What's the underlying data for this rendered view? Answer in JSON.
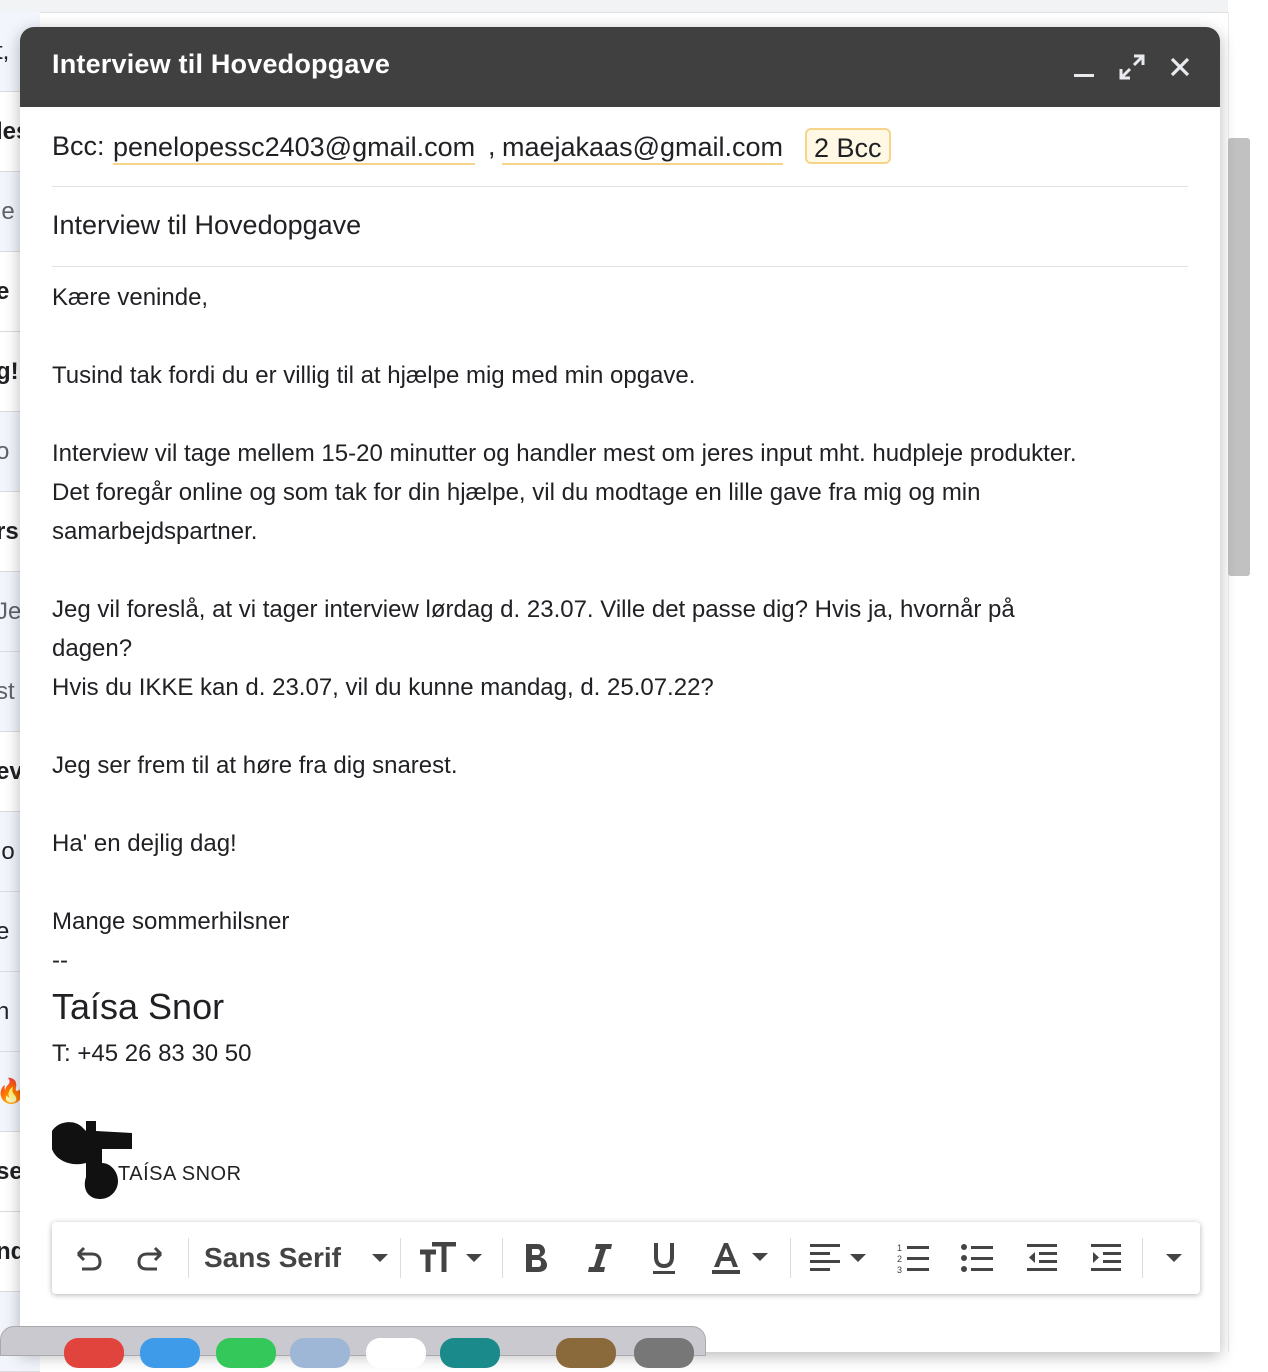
{
  "background_list": {
    "rows": [
      {
        "text": "t,",
        "style": "normal"
      },
      {
        "text": "les",
        "style": "bold"
      },
      {
        "text": "le",
        "style": "gray"
      },
      {
        "text": "e",
        "style": "bold"
      },
      {
        "text": "g!",
        "style": "bold"
      },
      {
        "text": "o",
        "style": "gray"
      },
      {
        "text": "rs",
        "style": "bold"
      },
      {
        "text": "Je",
        "style": "gray"
      },
      {
        "text": "st",
        "style": "gray"
      },
      {
        "text": "ev",
        "style": "bold"
      },
      {
        "text": "lo",
        "style": "normal"
      },
      {
        "text": "e",
        "style": "normal"
      },
      {
        "text": "h",
        "style": "normal"
      },
      {
        "text": "🔥",
        "style": "normal"
      },
      {
        "text": "se",
        "style": "bold"
      },
      {
        "text": "nd",
        "style": "bold"
      },
      {
        "text": "",
        "style": "normal"
      }
    ]
  },
  "compose": {
    "title": "Interview til Hovedopgave",
    "bcc_label": "Bcc:",
    "recipients": [
      "penelopessc2403@gmail.com",
      "maejakaas@gmail.com"
    ],
    "recipient_separator": ",",
    "bcc_count": "2 Bcc",
    "subject": "Interview til Hovedopgave",
    "body": {
      "greeting": "Kære veninde,",
      "p1": "Tusind tak fordi du er villig til at hjælpe mig med min opgave.",
      "p2_line1": "Interview vil tage mellem 15-20 minutter og handler mest om jeres input mht. hudpleje produkter.",
      "p2_line2": "Det foregår online og som tak for din hjælpe, vil du modtage en lille gave fra mig og min",
      "p2_line3": "samarbejdspartner.",
      "p3_line1": "Jeg vil foreslå, at vi tager interview lørdag d. 23.07. Ville det passe dig? Hvis ja, hvornår på",
      "p3_line2": "dagen?",
      "p3_line3": "Hvis du IKKE kan d. 23.07, vil du kunne mandag, d. 25.07.22?",
      "p4": "Jeg ser frem til at høre fra dig snarest.",
      "p5": "Ha' en dejlig dag!",
      "closing": "Mange sommerhilsner",
      "sig_separator": "--",
      "sig_name": "Taísa Snor",
      "sig_phone": "T: +45 26 83 30 50",
      "logo_text": "TAÍSA SNOR"
    }
  },
  "toolbar": {
    "font_name": "Sans Serif",
    "tools": [
      "undo-icon",
      "redo-icon",
      "font-family",
      "font-size-icon",
      "bold-icon",
      "italic-icon",
      "underline-icon",
      "text-color-icon",
      "align-icon",
      "numbered-list-icon",
      "bulleted-list-icon",
      "indent-less-icon",
      "indent-more-icon",
      "more-formatting-icon"
    ]
  },
  "colors": {
    "header_bg": "#404040",
    "chip_underline": "#f6d58a",
    "bcc_chip_bg": "#fff8e5"
  }
}
